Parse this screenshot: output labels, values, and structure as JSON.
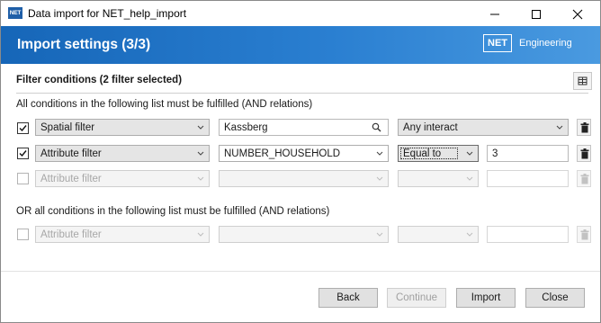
{
  "window": {
    "title": "Data import for NET_help_import",
    "icon_label": "NET"
  },
  "header": {
    "title": "Import settings (3/3)",
    "logo_box": "NET",
    "logo_text": "Engineering"
  },
  "filter": {
    "section_title": "Filter conditions (2 filter selected)",
    "and_text": "All conditions in the following list must be fulfilled (AND relations)",
    "or_text": "OR all conditions in the following list must be fulfilled (AND relations)",
    "rows": [
      {
        "checked": true,
        "type": "Spatial filter",
        "field": "Kassberg",
        "operator": "Any interact",
        "value": ""
      },
      {
        "checked": true,
        "type": "Attribute filter",
        "field": "NUMBER_HOUSEHOLD",
        "operator": "Equal to",
        "value": "3"
      },
      {
        "checked": false,
        "type": "Attribute filter",
        "field": "",
        "operator": "",
        "value": ""
      }
    ],
    "or_rows": [
      {
        "checked": false,
        "type": "Attribute filter",
        "field": "",
        "operator": "",
        "value": ""
      }
    ]
  },
  "buttons": {
    "back": "Back",
    "continue": "Continue",
    "import": "Import",
    "close": "Close"
  },
  "colors": {
    "header_start": "#1666b8",
    "header_end": "#4a9ae0"
  }
}
